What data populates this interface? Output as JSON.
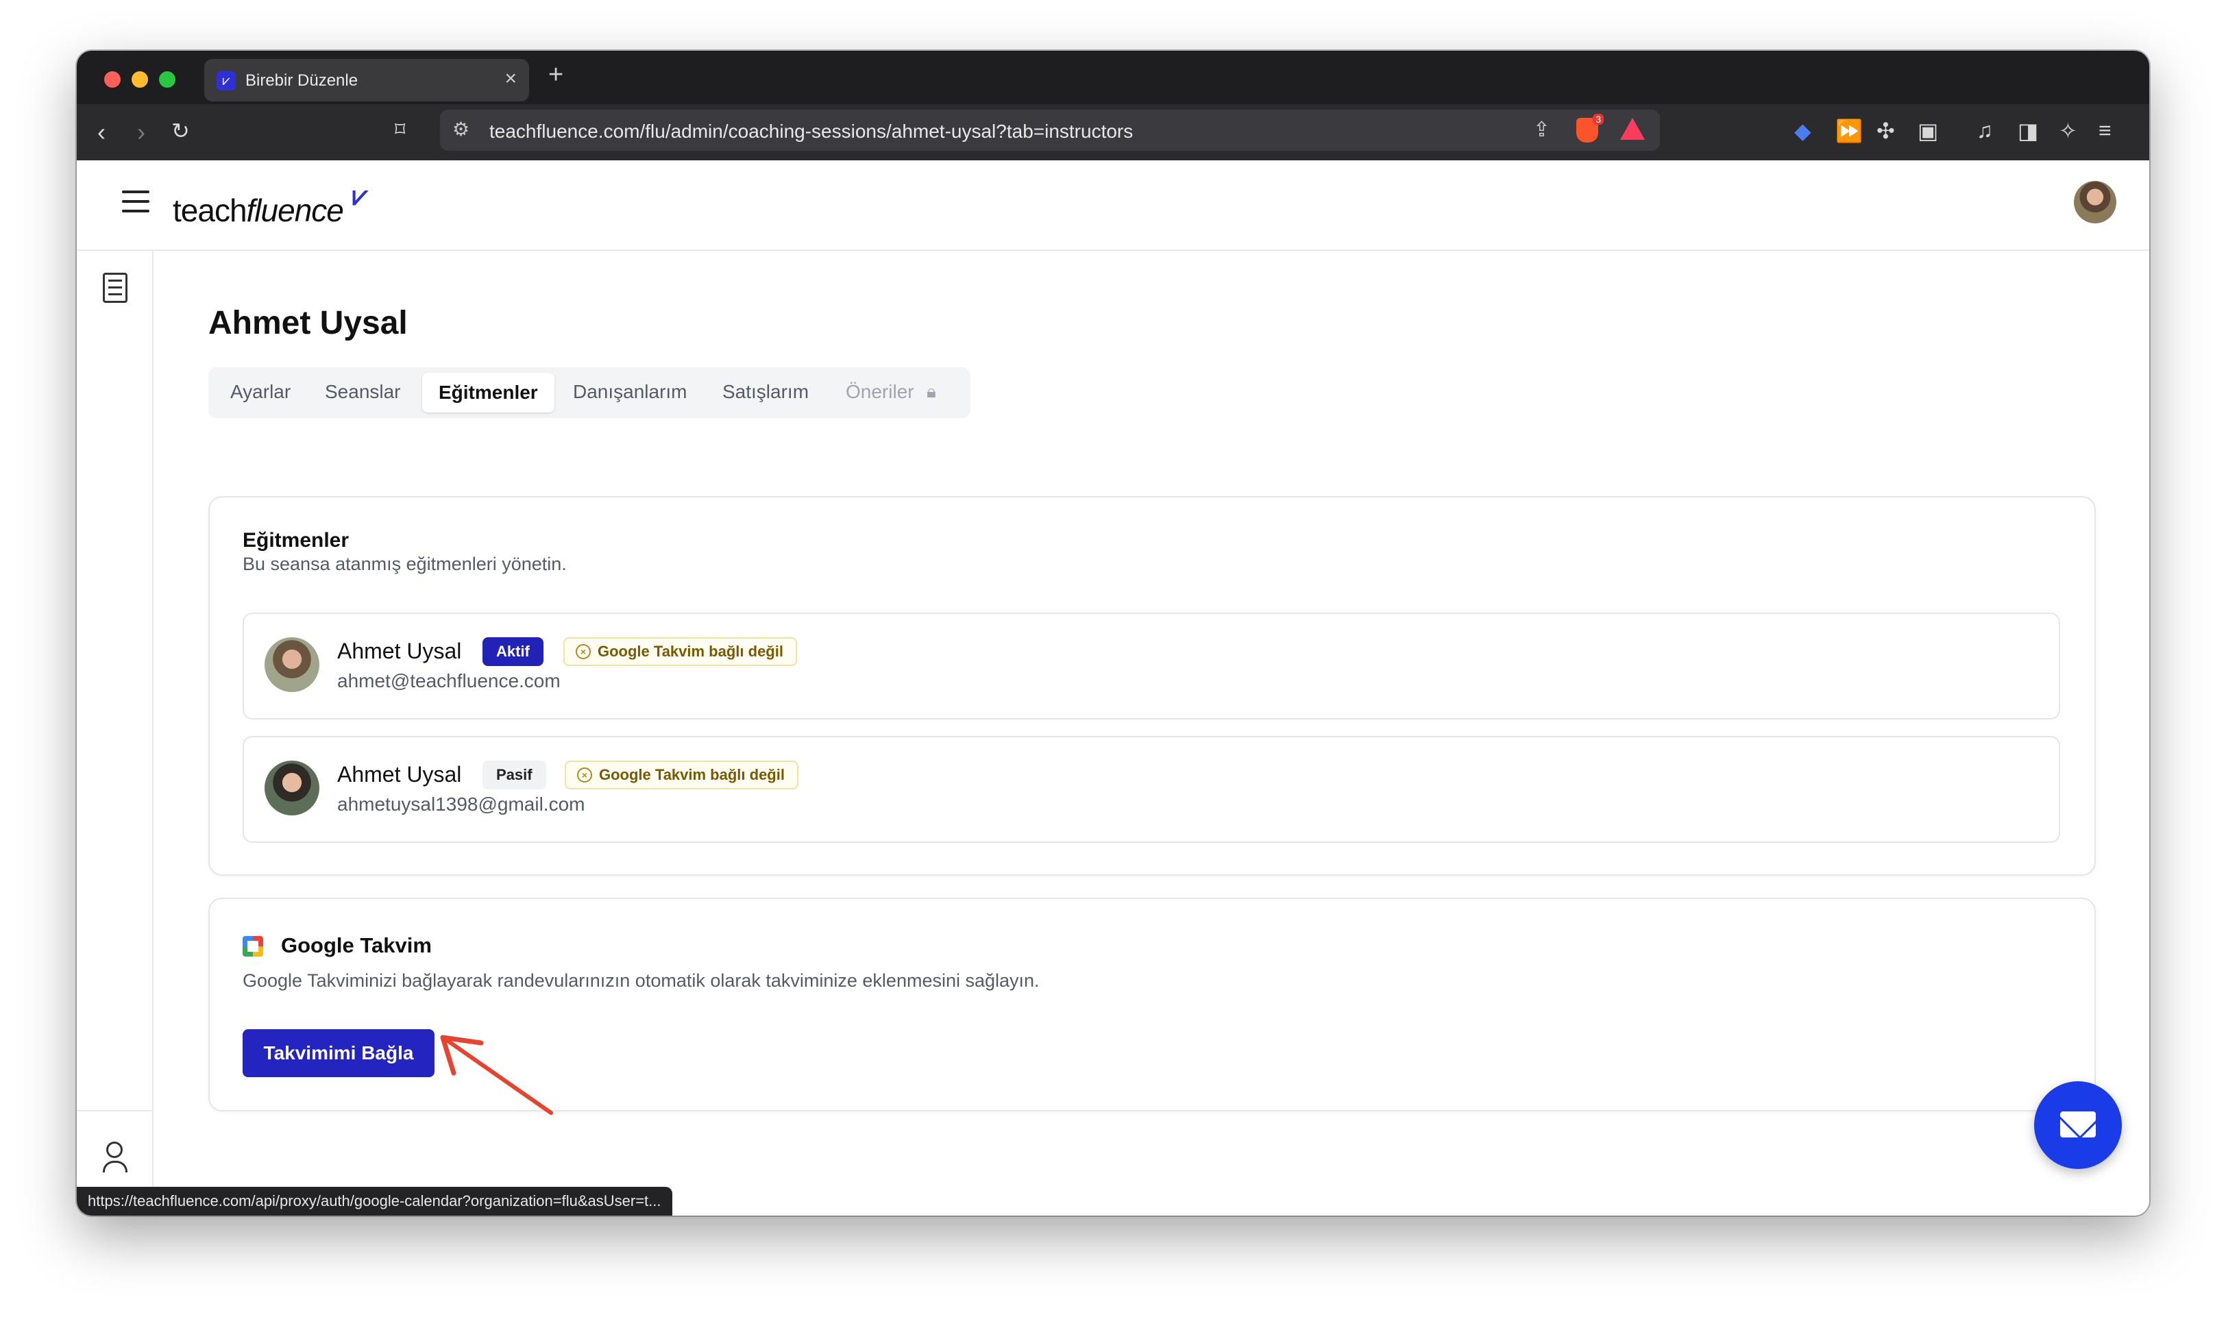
{
  "browser": {
    "tab_title": "Birebir Düzenle",
    "tab_close": "×",
    "new_tab": "+",
    "url": "teachfluence.com/flu/admin/coaching-sessions/ahmet-uysal?tab=instructors",
    "brave_badge": "3",
    "status_url": "https://teachfluence.com/api/proxy/auth/google-calendar?organization=flu&asUser=t..."
  },
  "app": {
    "logo_main": "teach",
    "logo_italic": "fluence"
  },
  "page": {
    "title": "Ahmet Uysal",
    "tabs": [
      {
        "label": "Ayarlar",
        "state": "normal"
      },
      {
        "label": "Seanslar",
        "state": "normal"
      },
      {
        "label": "Eğitmenler",
        "state": "active"
      },
      {
        "label": "Danışanlarım",
        "state": "normal"
      },
      {
        "label": "Satışlarım",
        "state": "normal"
      },
      {
        "label": "Öneriler",
        "state": "locked"
      }
    ]
  },
  "instructors_card": {
    "title": "Eğitmenler",
    "description": "Bu seansa atanmış eğitmenleri yönetin.",
    "rows": [
      {
        "name": "Ahmet Uysal",
        "status": "Aktif",
        "calendar": "Google Takvim bağlı değil",
        "email": "ahmet@teachfluence.com"
      },
      {
        "name": "Ahmet Uysal",
        "status": "Pasif",
        "calendar": "Google Takvim bağlı değil",
        "email": "ahmetuysal1398@gmail.com"
      }
    ]
  },
  "calendar_card": {
    "title": "Google Takvim",
    "description": "Google Takviminizi bağlayarak randevularınızın otomatik olarak takviminize eklenmesini sağlayın.",
    "button": "Takvimimi Bağla"
  },
  "colors": {
    "primary": "#2424c0",
    "fab": "#1a3be8",
    "annotation_arrow": "#e8432e"
  }
}
